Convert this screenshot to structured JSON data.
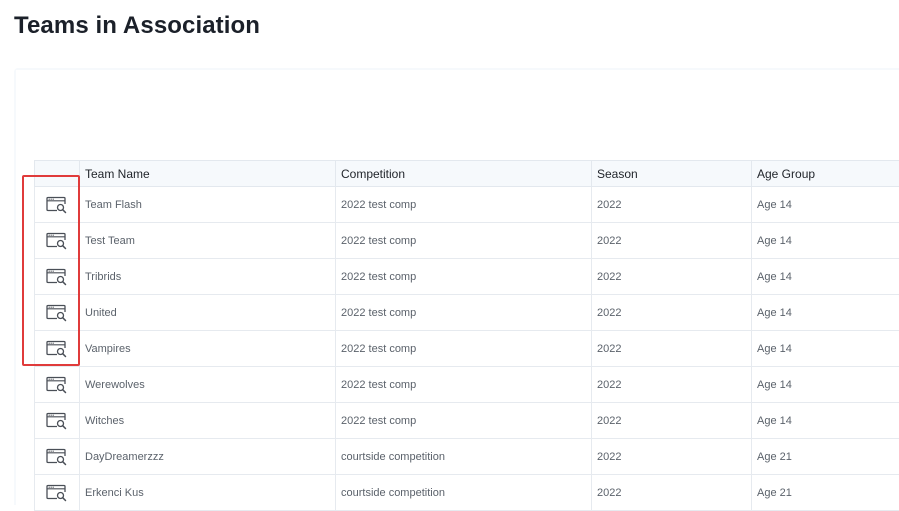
{
  "page": {
    "title": "Teams in Association"
  },
  "table": {
    "columns": [
      "",
      "Team Name",
      "Competition",
      "Season",
      "Age Group"
    ],
    "row_icon": "view-details-icon",
    "rows": [
      {
        "team": "Team Flash",
        "competition": "2022 test comp",
        "season": "2022",
        "age_group": "Age 14"
      },
      {
        "team": "Test Team",
        "competition": "2022 test comp",
        "season": "2022",
        "age_group": "Age 14"
      },
      {
        "team": "Tribrids",
        "competition": "2022 test comp",
        "season": "2022",
        "age_group": "Age 14"
      },
      {
        "team": "United",
        "competition": "2022 test comp",
        "season": "2022",
        "age_group": "Age 14"
      },
      {
        "team": "Vampires",
        "competition": "2022 test comp",
        "season": "2022",
        "age_group": "Age 14"
      },
      {
        "team": "Werewolves",
        "competition": "2022 test comp",
        "season": "2022",
        "age_group": "Age 14"
      },
      {
        "team": "Witches",
        "competition": "2022 test comp",
        "season": "2022",
        "age_group": "Age 14"
      },
      {
        "team": "DayDreamerzzz",
        "competition": "courtside competition",
        "season": "2022",
        "age_group": "Age 21"
      },
      {
        "team": "Erkenci Kus",
        "competition": "courtside competition",
        "season": "2022",
        "age_group": "Age 21"
      }
    ]
  },
  "colors": {
    "title": "#1b2029",
    "panel_bg": "#f6f9fc",
    "highlight": "#e03b3b",
    "icon": "#4a4f57"
  }
}
